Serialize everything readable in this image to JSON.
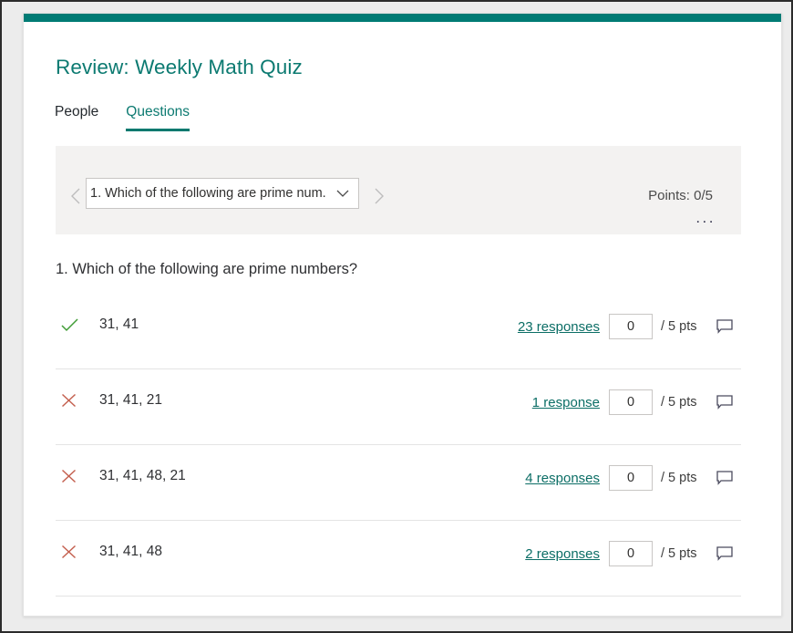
{
  "theme": {
    "accent_teal": "#007B74",
    "link_teal": "#0c6e66",
    "correct_green": "#3f9c35",
    "incorrect_red": "#c4604f",
    "panel_grey": "#f3f2f1"
  },
  "header": {
    "title": "Review: Weekly Math Quiz"
  },
  "tabs": [
    {
      "label": "People",
      "active": false,
      "name": "tab-people"
    },
    {
      "label": "Questions",
      "active": true,
      "name": "tab-questions"
    }
  ],
  "question_nav": {
    "prev_icon": "chevron-left-icon",
    "next_icon": "chevron-right-icon",
    "dropdown_value": "1. Which of the following are prime num...",
    "dropdown_caret_icon": "chevron-down-icon",
    "points_label": "Points: 0/5",
    "more_label": "..."
  },
  "question": {
    "text": "1. Which of the following are prime numbers?"
  },
  "answers": [
    {
      "label": "31, 41",
      "status": "correct",
      "status_icon": "checkmark-icon",
      "responses_label": "23 responses",
      "score_value": "0",
      "score_suffix": "/ 5 pts",
      "comment_icon": "comment-bubble-icon"
    },
    {
      "label": "31, 41, 21",
      "status": "incorrect",
      "status_icon": "cross-icon",
      "responses_label": "1 response",
      "score_value": "0",
      "score_suffix": "/ 5 pts",
      "comment_icon": "comment-bubble-icon"
    },
    {
      "label": "31, 41, 48, 21",
      "status": "incorrect",
      "status_icon": "cross-icon",
      "responses_label": "4 responses",
      "score_value": "0",
      "score_suffix": "/ 5 pts",
      "comment_icon": "comment-bubble-icon"
    },
    {
      "label": "31, 41, 48",
      "status": "incorrect",
      "status_icon": "cross-icon",
      "responses_label": "2 responses",
      "score_value": "0",
      "score_suffix": "/ 5 pts",
      "comment_icon": "comment-bubble-icon"
    }
  ]
}
